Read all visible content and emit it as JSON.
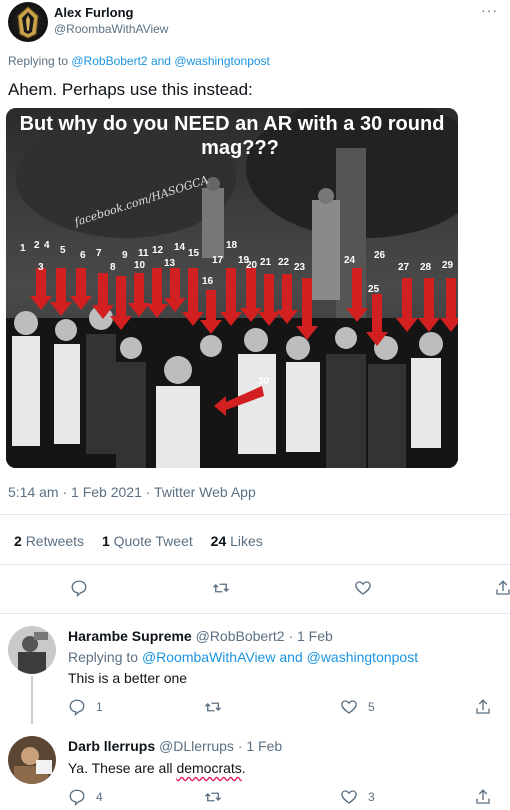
{
  "main_tweet": {
    "author_name": "Alex Furlong",
    "author_handle": "@RoombaWithAView",
    "more_label": "···",
    "replying_prefix": "Replying to ",
    "replying_user1": "@RobBobert2",
    "replying_and": " and ",
    "replying_user2": "@washingtonpost",
    "text": "Ahem. Perhaps use this instead:",
    "image": {
      "caption_line1": "But why do you NEED an AR with a 30 round",
      "caption_line2": "mag???",
      "watermark": "facebook.com/HASOGCA",
      "numbers": [
        "1",
        "2",
        "4",
        "5",
        "6",
        "7",
        "9",
        "11",
        "12",
        "14",
        "15",
        "18",
        "3",
        "8",
        "10",
        "13",
        "16",
        "17",
        "19",
        "20",
        "21",
        "22",
        "23",
        "24",
        "26",
        "25",
        "27",
        "28",
        "29",
        "30"
      ]
    },
    "timestamp": "5:14 am · 1 Feb 2021 · Twitter Web App",
    "stats": {
      "retweets_count": "2",
      "retweets_label": "Retweets",
      "quotes_count": "1",
      "quotes_label": "Quote Tweet",
      "likes_count": "24",
      "likes_label": "Likes"
    },
    "icons": [
      "reply-icon",
      "retweet-icon",
      "like-icon",
      "share-icon"
    ]
  },
  "replies": [
    {
      "name": "Harambe Supreme",
      "handle": "@RobBobert2",
      "time": "· 1 Feb",
      "replying_prefix": "Replying to ",
      "replying_user1": "@RoombaWithAView",
      "replying_and": " and ",
      "replying_user2": "@washingtonpost",
      "text": "This is a better one",
      "reply_count": "1",
      "retweet_count": "",
      "like_count": "5"
    },
    {
      "name": "Darb llerrups",
      "handle": "@DLlerrups",
      "time": "· 1 Feb",
      "text_prefix": "Ya. These are all ",
      "text_underlined": "democrats",
      "text_suffix": ".",
      "reply_count": "4",
      "retweet_count": "",
      "like_count": "3"
    }
  ],
  "colors": {
    "link": "#1b95e0",
    "muted": "#5b7083",
    "divider": "#e1e8ed",
    "arrow_red": "#d21f1f",
    "spellcheck": "#e0245e"
  }
}
